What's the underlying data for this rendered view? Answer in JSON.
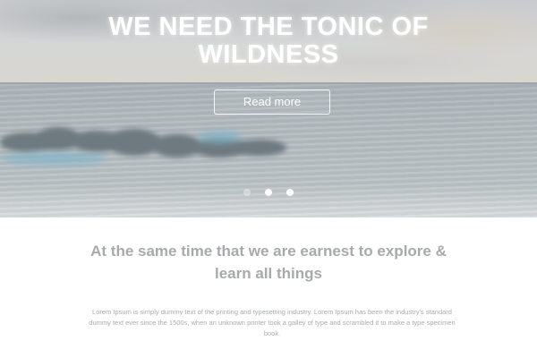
{
  "hero": {
    "title_line1": "WE NEED THE TONIC OF",
    "title_line2": "WILDNESS",
    "button_label": "Read more",
    "slides": {
      "total": 3,
      "active": 2
    }
  },
  "content": {
    "subheading_line1": "At the same time that we are earnest to explore &",
    "subheading_line2": "learn all things",
    "body_line1": "Lorem Ipsum is simply dummy text of the printing and typesetting industry. Lorem Ipsum has been the industry's standard",
    "body_line2": "dummy text ever since the 1500s, when an unknown printer took a galley of type and scrambled it to make a type specimen",
    "body_line3": "book."
  }
}
